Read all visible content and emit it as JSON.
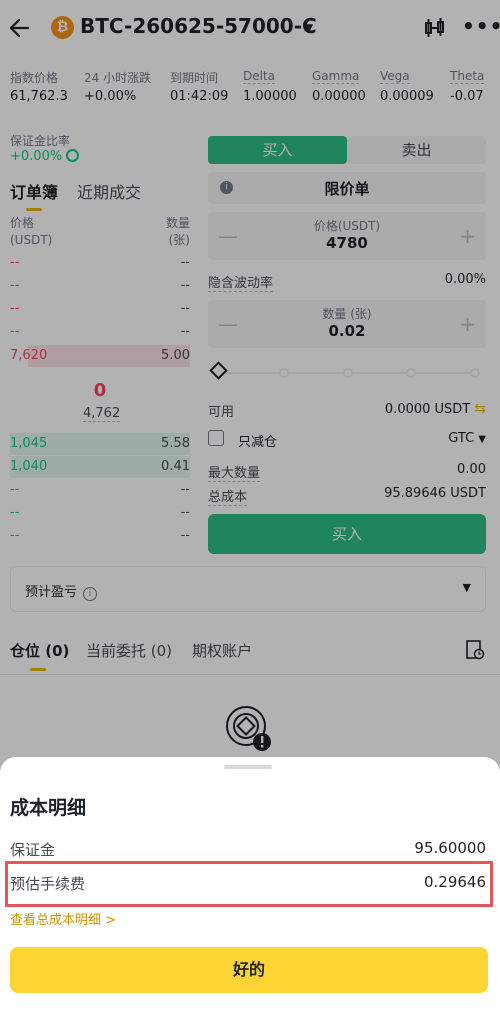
{
  "header": {
    "instrument": "BTC-260625-57000-C",
    "coin_symbol": "₿"
  },
  "stats": [
    {
      "label": "指数价格",
      "value": "61,762.3"
    },
    {
      "label": "24 小时涨跌",
      "value": "+0.00%"
    },
    {
      "label": "到期时间",
      "value": "01:42:09"
    },
    {
      "label": "Delta",
      "value": "1.00000"
    },
    {
      "label": "Gamma",
      "value": "0.00000"
    },
    {
      "label": "Vega",
      "value": "0.00009"
    },
    {
      "label": "Theta",
      "value": "-0.07"
    }
  ],
  "margin": {
    "label": "保证金比率",
    "value": "+0.00%"
  },
  "book": {
    "tabs": [
      "订单簿",
      "近期成交"
    ],
    "price_header": [
      "价格",
      "(USDT)"
    ],
    "qty_header": [
      "数量",
      "(张)"
    ],
    "asks": [
      {
        "price": "--",
        "qty": "--"
      },
      {
        "price": "--",
        "qty": "--"
      },
      {
        "price": "--",
        "qty": "--"
      },
      {
        "price": "--",
        "qty": "--"
      },
      {
        "price": "7,620",
        "qty": "5.00"
      }
    ],
    "mid_price": "0",
    "mark_price": "4,762",
    "bids": [
      {
        "price": "1,045",
        "qty": "5.58"
      },
      {
        "price": "1,040",
        "qty": "0.41"
      },
      {
        "price": "--",
        "qty": "--"
      },
      {
        "price": "--",
        "qty": "--"
      },
      {
        "price": "--",
        "qty": "--"
      }
    ]
  },
  "form": {
    "buy_tab": "买入",
    "sell_tab": "卖出",
    "order_type": "限价单",
    "price_label": "价格(USDT)",
    "price_value": "4780",
    "iv_label": "隐含波动率",
    "iv_value": "0.00%",
    "qty_label": "数量 (张)",
    "qty_value": "0.02",
    "available_label": "可用",
    "available_value": "0.0000 USDT",
    "reduce_only_label": "只减仓",
    "tif_value": "GTC",
    "max_qty_label": "最大数量",
    "max_qty_value": "0.00",
    "total_cost_label": "总成本",
    "total_cost_value": "95.89646 USDT",
    "buy_button": "买入"
  },
  "pnl": {
    "label": "预计盈亏"
  },
  "positions": {
    "tabs": [
      "仓位 (0)",
      "当前委托 (0)",
      "期权账户"
    ]
  },
  "sheet": {
    "title": "成本明细",
    "rows": [
      {
        "label": "保证金",
        "value": "95.60000"
      },
      {
        "label": "预估手续费",
        "value": "0.29646"
      }
    ],
    "link": "查看总成本明细 >",
    "ok_button": "好的"
  },
  "colors": {
    "buy": "#2ebd85",
    "sell": "#f6465d",
    "accent": "#fcd535",
    "highlight_box": "#e05a5a"
  }
}
